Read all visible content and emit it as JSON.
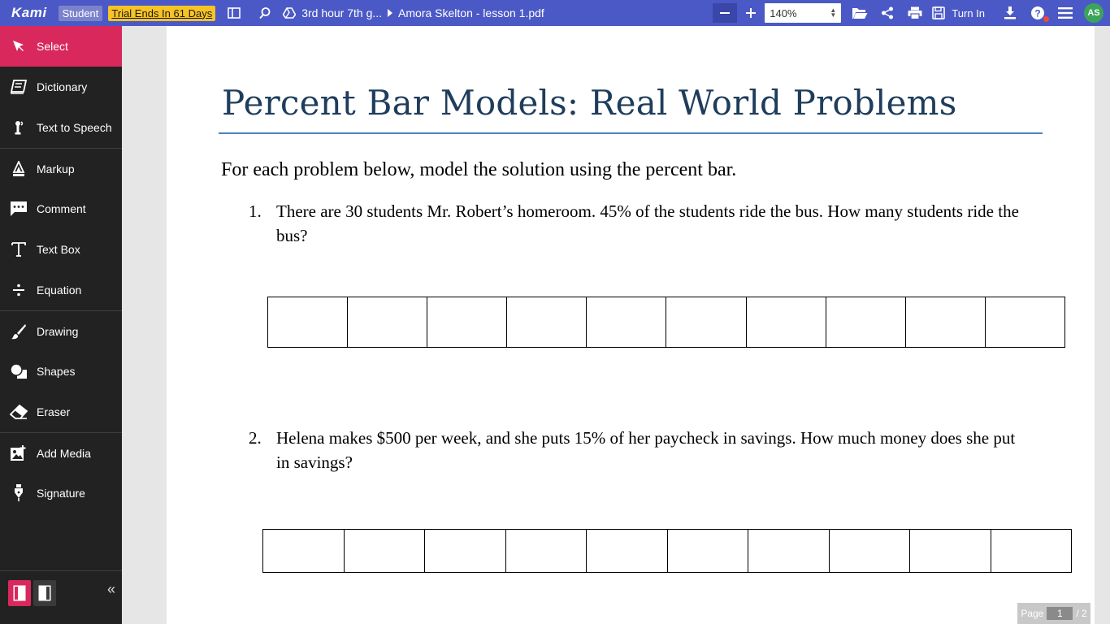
{
  "topbar": {
    "logo": "Kami",
    "role": "Student",
    "trial": "Trial Ends In 61 Days",
    "breadcrumb_folder": "3rd hour 7th g...",
    "breadcrumb_file": "Amora Skelton - lesson 1.pdf",
    "zoom": "140%",
    "turn_in": "Turn In",
    "avatar_initials": "AS",
    "color": "#4b59c6"
  },
  "sidebar": {
    "items": [
      {
        "label": "Select",
        "icon": "cursor-icon"
      },
      {
        "label": "Dictionary",
        "icon": "book-icon"
      },
      {
        "label": "Text to Speech",
        "icon": "speaker-icon"
      },
      {
        "label": "Markup",
        "icon": "highlighter-icon"
      },
      {
        "label": "Comment",
        "icon": "comment-icon"
      },
      {
        "label": "Text Box",
        "icon": "text-icon"
      },
      {
        "label": "Equation",
        "icon": "divide-icon"
      },
      {
        "label": "Drawing",
        "icon": "brush-icon"
      },
      {
        "label": "Shapes",
        "icon": "shapes-icon"
      },
      {
        "label": "Eraser",
        "icon": "eraser-icon"
      },
      {
        "label": "Add Media",
        "icon": "image-icon"
      },
      {
        "label": "Signature",
        "icon": "pen-nib-icon"
      }
    ],
    "accent": "#d9285c"
  },
  "document": {
    "title": "Percent Bar Models: Real World Problems",
    "intro": "For each problem below, model the solution using the percent bar.",
    "problems": [
      {
        "number": "1.",
        "text": " There are 30 students Mr. Robert’s homeroom.  45% of the students ride the bus.  How many students ride the bus?"
      },
      {
        "number": "2.",
        "text": " Helena makes $500 per week, and she puts 15% of her paycheck in savings.  How much money does she put in savings?"
      }
    ]
  },
  "pager": {
    "label": "Page",
    "current": "1",
    "total": "/ 2"
  }
}
